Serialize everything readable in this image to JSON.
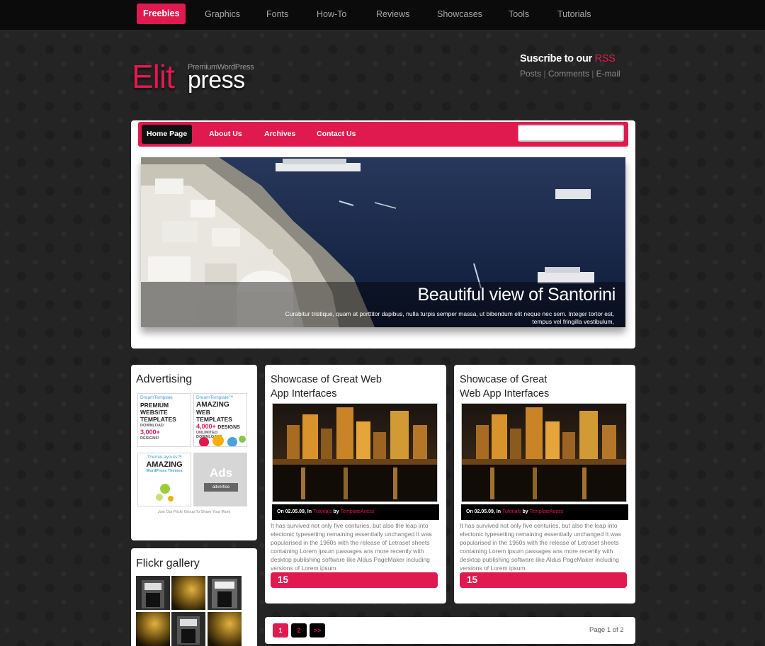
{
  "topnav": {
    "items": [
      "Freebies",
      "Graphics",
      "Fonts",
      "How-To",
      "Reviews",
      "Showcases",
      "Tools",
      "Tutorials"
    ]
  },
  "logo": {
    "elit": "Elit",
    "press": "press",
    "tagline": "PremiumWordPress"
  },
  "subscribe": {
    "title": "Suscribe to our",
    "rss": "RSS",
    "links": [
      "Posts",
      "Comments",
      "E-mail"
    ],
    "sep": "|"
  },
  "mainnav": {
    "items": [
      "Home Page",
      "About Us",
      "Archives",
      "Contact Us"
    ],
    "search_placeholder": ""
  },
  "hero": {
    "title": "Beautiful view of Santorini",
    "text": "Curabitur tristique, quam at porttitor dapibus, nulla turpis semper massa, ut bibendum elit neque nec sem. Integer tortor est, tempus vel fringilla vestibulum,"
  },
  "sidebar": {
    "advertising_title": "Advertising",
    "ads": [
      {
        "brand": "DreamTemplate",
        "lines": [
          "PREMIUM",
          "WEBSITE",
          "TEMPLATES"
        ],
        "small": "DOWNLOAD",
        "accent": "3,000+",
        "small2": "DESIGNS!"
      },
      {
        "brand": "DreamTemplate™",
        "lines": [
          "AMAZING",
          "WEB TEMPLATES"
        ],
        "accent": "4,000+",
        "accent_suffix": "DESIGNS",
        "small": "UNLIMITED DOWNLOADS"
      },
      {
        "brand": "ThemeLayouts™",
        "lines": [
          "AMAZING"
        ],
        "small": "WordPress Themes"
      },
      {
        "ads_label": "Ads",
        "button": "advertise"
      }
    ],
    "flickr_note": "Join Our Flickr Group To Share Your Work",
    "flickr_title": "Flickr gallery"
  },
  "posts": [
    {
      "title_lines": [
        "Showcase of Great Web",
        "App Interfaces"
      ],
      "meta_prefix": "On 02.05.09, In",
      "category": "Tutorials",
      "meta_by": "by",
      "author": "TemplateAcess",
      "body": "It has survived not only five centuries, but also the leap into electonic typesetting remaining essentially unchanged It was popularised in the 1960s with the release of Letraset sheets containing Lorem ipsum passages ans more recently with desktop publishing software like Aldus PageMaker including versions of Lorem ipsum.",
      "count": "15"
    },
    {
      "title_lines": [
        "Showcase of Great",
        "Web App Interfaces"
      ],
      "meta_prefix": "On 02.05.09, In",
      "category": "Tutorials",
      "meta_by": "by",
      "author": "TemplateAcess",
      "body": "It has survived not only five centuries, but also the leap into electonic typesetting remaining essentially unchanged It was popularised in the 1960s with the release of Letraset sheets containing Lorem ipsum passages ans more recently with desktop publishing software like Aldus PageMaker including versions of Lorem ipsum.",
      "count": "15"
    }
  ],
  "pagination": {
    "pages": [
      "1",
      "2",
      ">>"
    ],
    "status": "Page 1 of 2"
  },
  "colors": {
    "accent": "#e01a4f",
    "background": "#242424",
    "topbar": "#0b0b0b"
  }
}
